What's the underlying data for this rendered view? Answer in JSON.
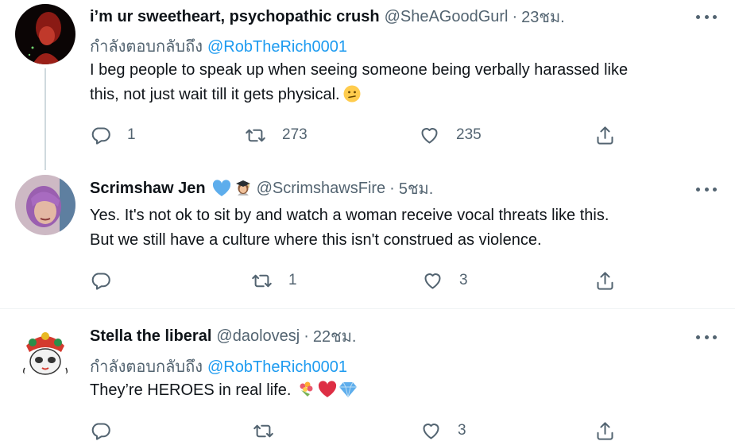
{
  "tweets": [
    {
      "name": "i’m ur sweetheart, psychopathic crush",
      "handle": "@SheAGoodGurl",
      "dot": "·",
      "time": "23ชม.",
      "reply_prefix": "กำลังตอบกลับถึง",
      "reply_to": "@RobTheRich0001",
      "text_lines": [
        "I beg people to speak up when seeing someone being verbally harassed like",
        "this, not just wait till it gets physical."
      ],
      "emoji": "confused-face-emoji",
      "replies": "1",
      "retweets": "273",
      "likes": "235"
    },
    {
      "name": "Scrimshaw Jen",
      "handle": "@ScrimshawsFire",
      "dot": "·",
      "time": "5ชม.",
      "badges": [
        "blue-heart-emoji",
        "woman-graduate-emoji"
      ],
      "text_lines": [
        "Yes. It's not ok to sit by and watch a woman receive vocal threats like this.",
        "But we still have a culture where this isn't construed as violence."
      ],
      "replies": "",
      "retweets": "1",
      "likes": "3"
    },
    {
      "name": "Stella the liberal",
      "handle": "@daolovesj",
      "dot": "·",
      "time": "22ชม.",
      "reply_prefix": "กำลังตอบกลับถึง",
      "reply_to": "@RobTheRich0001",
      "text_lines": [
        "They’re HEROES in real life."
      ],
      "emojis": [
        "bouquet-emoji",
        "red-heart-emoji",
        "gem-emoji"
      ],
      "replies": "",
      "retweets": "",
      "likes": "3"
    }
  ],
  "colors": {
    "link": "#1d9bf0",
    "secondary": "#536471",
    "text": "#0f1419",
    "thread_line": "#cfd9de"
  }
}
